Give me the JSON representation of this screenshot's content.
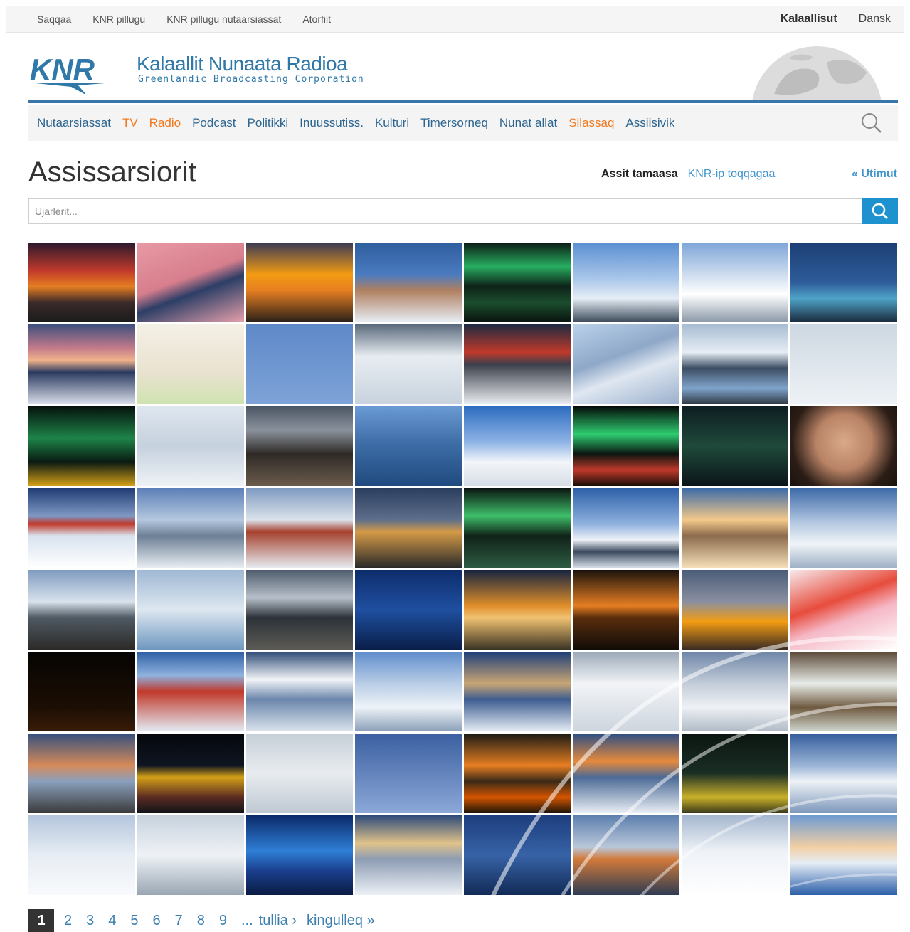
{
  "topbar": {
    "links": [
      "Saqqaa",
      "KNR pillugu",
      "KNR pillugu nutaarsiassat",
      "Atorfiit"
    ],
    "languages": [
      {
        "label": "Kalaallisut",
        "active": true
      },
      {
        "label": "Dansk",
        "active": false
      }
    ]
  },
  "brand": {
    "logo_text": "KNR",
    "title": "Kalaallit Nunaata Radioa",
    "subtitle": "Greenlandic Broadcasting Corporation"
  },
  "nav": {
    "items": [
      {
        "label": "Nutaarsiassat",
        "hot": false
      },
      {
        "label": "TV",
        "hot": true
      },
      {
        "label": "Radio",
        "hot": true
      },
      {
        "label": "Podcast",
        "hot": false
      },
      {
        "label": "Politikki",
        "hot": false
      },
      {
        "label": "Inuussutiss.",
        "hot": false
      },
      {
        "label": "Kulturi",
        "hot": false
      },
      {
        "label": "Timersorneq",
        "hot": false
      },
      {
        "label": "Nunat allat",
        "hot": false
      },
      {
        "label": "Silassaq",
        "hot": true
      },
      {
        "label": "Assiisivik",
        "hot": false
      }
    ],
    "search_icon": "search-icon"
  },
  "page": {
    "title": "Assissarsiorit",
    "category_active": "Assit tamaasa",
    "category_link": "KNR-ip toqqagaa",
    "back_link": "« Utimut"
  },
  "search": {
    "placeholder": "Ujarlerit..."
  },
  "pagination": {
    "current": "1",
    "pages": [
      "2",
      "3",
      "4",
      "5",
      "6",
      "7",
      "8",
      "9"
    ],
    "ellipsis": "...",
    "next": "tullia ›",
    "last": "kingulleq »"
  },
  "colors": {
    "brand_blue": "#2f78a8",
    "accent_orange": "#f07a22",
    "link_blue": "#3f95cc",
    "search_button": "#1e91cf"
  },
  "photos": [
    "sunset-house",
    "pink-water-ice",
    "orange-sunset-island",
    "carved-sculpture-snow",
    "green-aurora-lake",
    "hikers-snowy-peak",
    "snowy-ridge",
    "blue-evening-building",
    "pink-dusk-bay",
    "child-drawing",
    "eagle-flight",
    "ice-sculptures",
    "red-horizon-town",
    "sun-glare-rope",
    "fjord-mirror",
    "eagle-landing",
    "green-aurora-dark",
    "snowy-hills",
    "moon-rocks-night",
    "blue-boats-harbor",
    "snow-mountains-blue",
    "aurora-town-lights",
    "aurora-soft-sky",
    "woman-portrait",
    "red-house-snow",
    "blue-sea-snow",
    "village-houses-snow",
    "town-sunset-lights",
    "aurora-green-lake",
    "mountain-range-snow",
    "sunset-slope",
    "snow-plain-sun",
    "low-sun-beach-stones",
    "iceberg-blue",
    "sunrise-shore",
    "blue-mountains-night",
    "orange-sunset-buildings",
    "dark-sunset-clouds",
    "orange-sunset-hill",
    "children-red-hats",
    "black-night",
    "colorful-town-snow",
    "bright-sun-snowfield",
    "bare-tree-snow",
    "sunset-valley",
    "frosted-plant",
    "snow-sky-horizon",
    "bird-on-rock",
    "town-sunset-red",
    "night-city-lights",
    "eagle-spread-wings",
    "eagle-dark-sky",
    "orange-railings",
    "sunset-ice-sea",
    "green-light-dark",
    "blue-sea-horizon",
    "white-dog-snow",
    "snowy-fence",
    "night-walkers-blue",
    "sunset-snow-road",
    "blue-lights-bay",
    "dusk-town-sea",
    "skier-snow-trail",
    "blue-village-snow"
  ]
}
